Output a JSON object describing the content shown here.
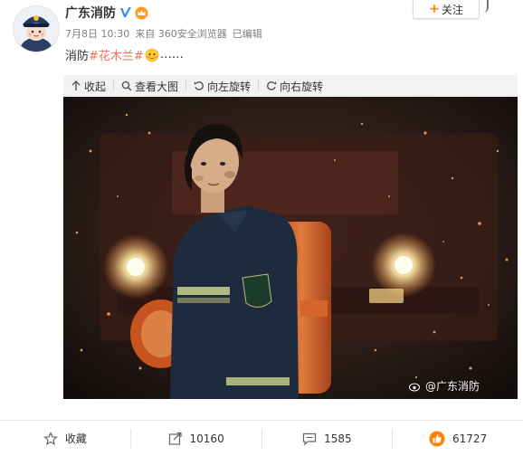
{
  "author": {
    "name": "广东消防",
    "verified_icon": "verified-v-icon",
    "vip_icon": "vip-crown-icon"
  },
  "follow_button": {
    "plus": "+",
    "label": "关注"
  },
  "meta": {
    "time": "7月8日 10:30",
    "source": "来自 360安全浏览器",
    "edited": "已编辑"
  },
  "content": {
    "prefix": "消防",
    "hashtag": "#花木兰#",
    "emoji": "blush-smiley-icon",
    "ellipsis": "……"
  },
  "media_toolbar": {
    "collapse": "收起",
    "view_large": "查看大图",
    "rotate_left": "向左旋转",
    "rotate_right": "向右旋转"
  },
  "photo": {
    "watermark": "@广东消防",
    "patch_text": "消防",
    "accent_color": "#e07a3a"
  },
  "actions": {
    "favorite": "收藏",
    "repost_count": "10160",
    "comment_count": "1585",
    "like_count": "61727"
  },
  "colors": {
    "link": "#eb7350",
    "toolbar_bg": "#f2f2f5",
    "like": "#ff8200"
  }
}
